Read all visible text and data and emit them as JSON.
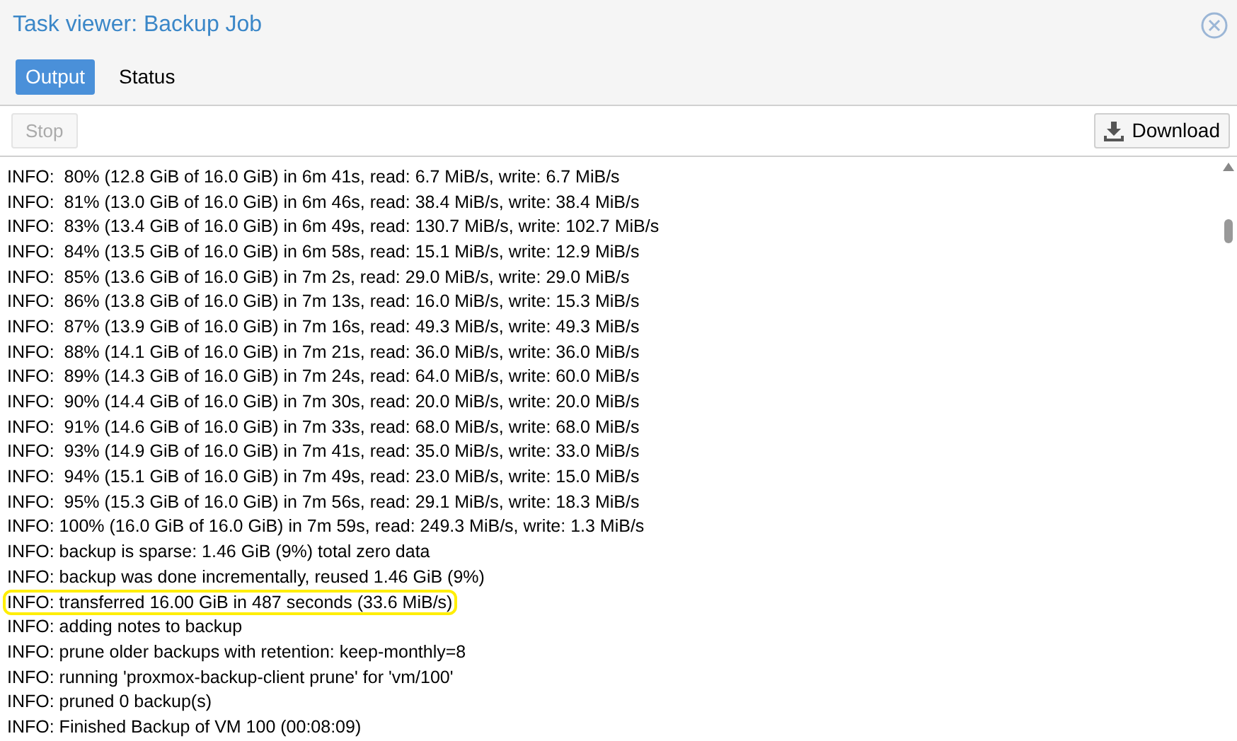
{
  "window": {
    "title": "Task viewer: Backup Job"
  },
  "tabs": [
    {
      "label": "Output",
      "selected": true
    },
    {
      "label": "Status",
      "selected": false
    }
  ],
  "toolbar": {
    "stop": {
      "label": "Stop",
      "disabled": true
    },
    "download": {
      "label": "Download"
    }
  },
  "log": [
    {
      "text": "INFO:  80% (12.8 GiB of 16.0 GiB) in 6m 41s, read: 6.7 MiB/s, write: 6.7 MiB/s",
      "highlighted": false
    },
    {
      "text": "INFO:  81% (13.0 GiB of 16.0 GiB) in 6m 46s, read: 38.4 MiB/s, write: 38.4 MiB/s",
      "highlighted": false
    },
    {
      "text": "INFO:  83% (13.4 GiB of 16.0 GiB) in 6m 49s, read: 130.7 MiB/s, write: 102.7 MiB/s",
      "highlighted": false
    },
    {
      "text": "INFO:  84% (13.5 GiB of 16.0 GiB) in 6m 58s, read: 15.1 MiB/s, write: 12.9 MiB/s",
      "highlighted": false
    },
    {
      "text": "INFO:  85% (13.6 GiB of 16.0 GiB) in 7m 2s, read: 29.0 MiB/s, write: 29.0 MiB/s",
      "highlighted": false
    },
    {
      "text": "INFO:  86% (13.8 GiB of 16.0 GiB) in 7m 13s, read: 16.0 MiB/s, write: 15.3 MiB/s",
      "highlighted": false
    },
    {
      "text": "INFO:  87% (13.9 GiB of 16.0 GiB) in 7m 16s, read: 49.3 MiB/s, write: 49.3 MiB/s",
      "highlighted": false
    },
    {
      "text": "INFO:  88% (14.1 GiB of 16.0 GiB) in 7m 21s, read: 36.0 MiB/s, write: 36.0 MiB/s",
      "highlighted": false
    },
    {
      "text": "INFO:  89% (14.3 GiB of 16.0 GiB) in 7m 24s, read: 64.0 MiB/s, write: 60.0 MiB/s",
      "highlighted": false
    },
    {
      "text": "INFO:  90% (14.4 GiB of 16.0 GiB) in 7m 30s, read: 20.0 MiB/s, write: 20.0 MiB/s",
      "highlighted": false
    },
    {
      "text": "INFO:  91% (14.6 GiB of 16.0 GiB) in 7m 33s, read: 68.0 MiB/s, write: 68.0 MiB/s",
      "highlighted": false
    },
    {
      "text": "INFO:  93% (14.9 GiB of 16.0 GiB) in 7m 41s, read: 35.0 MiB/s, write: 33.0 MiB/s",
      "highlighted": false
    },
    {
      "text": "INFO:  94% (15.1 GiB of 16.0 GiB) in 7m 49s, read: 23.0 MiB/s, write: 15.0 MiB/s",
      "highlighted": false
    },
    {
      "text": "INFO:  95% (15.3 GiB of 16.0 GiB) in 7m 56s, read: 29.1 MiB/s, write: 18.3 MiB/s",
      "highlighted": false
    },
    {
      "text": "INFO: 100% (16.0 GiB of 16.0 GiB) in 7m 59s, read: 249.3 MiB/s, write: 1.3 MiB/s",
      "highlighted": false
    },
    {
      "text": "INFO: backup is sparse: 1.46 GiB (9%) total zero data",
      "highlighted": false
    },
    {
      "text": "INFO: backup was done incrementally, reused 1.46 GiB (9%)",
      "highlighted": false
    },
    {
      "text": "INFO: transferred 16.00 GiB in 487 seconds (33.6 MiB/s)",
      "highlighted": true
    },
    {
      "text": "INFO: adding notes to backup",
      "highlighted": false
    },
    {
      "text": "INFO: prune older backups with retention: keep-monthly=8",
      "highlighted": false
    },
    {
      "text": "INFO: running 'proxmox-backup-client prune' for 'vm/100'",
      "highlighted": false
    },
    {
      "text": "INFO: pruned 0 backup(s)",
      "highlighted": false
    },
    {
      "text": "INFO: Finished Backup of VM 100 (00:08:09)",
      "highlighted": false
    }
  ]
}
